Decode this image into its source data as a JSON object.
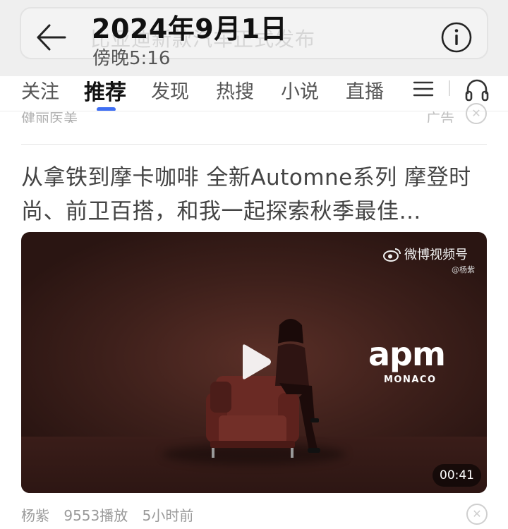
{
  "header": {
    "ghost_search_text": "比亚迪新款汽车正式发布",
    "date": "2024年9月1日",
    "time": "傍晚5:16",
    "back_icon": "arrow-left-icon",
    "info_icon": "info-circle-icon"
  },
  "tabs": [
    {
      "label": "关注",
      "active": false
    },
    {
      "label": "推荐",
      "active": true
    },
    {
      "label": "发现",
      "active": false
    },
    {
      "label": "热搜",
      "active": false
    },
    {
      "label": "小说",
      "active": false
    },
    {
      "label": "直播",
      "active": false
    }
  ],
  "tab_icons": {
    "menu": "menu-icon",
    "listen": "headphones-icon"
  },
  "ad": {
    "source": "健丽医美",
    "label": "广告"
  },
  "article": {
    "title": "从拿铁到摩卡咖啡 全新Automne系列 摩登时尚、前卫百搭，和我一起探索秋季最佳…",
    "video": {
      "watermark": "微博视频号",
      "watermark_handle": "@杨紫",
      "brand": "apm",
      "brand_sub": "MONACO",
      "duration": "00:41"
    },
    "meta": {
      "author": "杨紫",
      "plays": "9553播放",
      "time_ago": "5小时前"
    }
  },
  "colors": {
    "accent": "#3f6ff3",
    "header_bg": "#efefef",
    "video_bg": "#3e201b"
  }
}
